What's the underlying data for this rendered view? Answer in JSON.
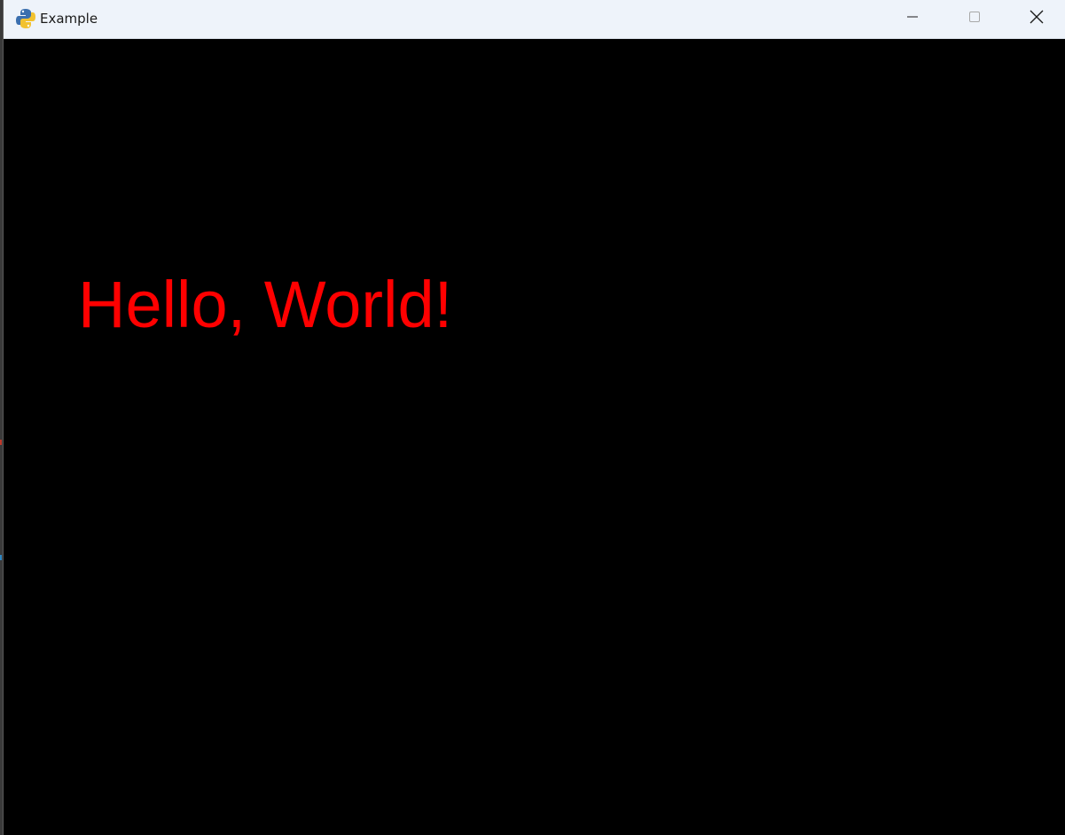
{
  "window": {
    "title": "Example",
    "app_icon": "python-snake-icon",
    "controls": {
      "minimize_icon": "minimize-icon",
      "maximize_icon": "maximize-icon",
      "close_icon": "close-icon"
    }
  },
  "canvas": {
    "background": "#000000",
    "text": "Hello, World!",
    "text_color": "#ff0000"
  }
}
